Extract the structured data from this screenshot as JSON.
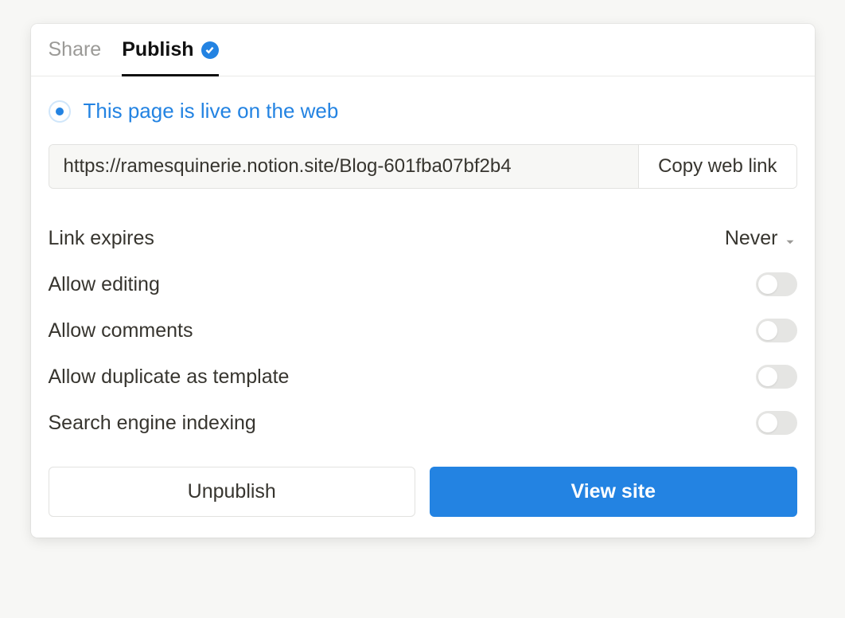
{
  "tabs": {
    "share": "Share",
    "publish": "Publish"
  },
  "status": {
    "live_text": "This page is live on the web"
  },
  "url": {
    "value": "https://ramesquinerie.notion.site/Blog-601fba07bf2b4",
    "copy_label": "Copy web link"
  },
  "settings": {
    "link_expires": {
      "label": "Link expires",
      "value": "Never"
    },
    "allow_editing": {
      "label": "Allow editing",
      "enabled": false
    },
    "allow_comments": {
      "label": "Allow comments",
      "enabled": false
    },
    "allow_duplicate": {
      "label": "Allow duplicate as template",
      "enabled": false
    },
    "search_indexing": {
      "label": "Search engine indexing",
      "enabled": false
    }
  },
  "buttons": {
    "unpublish": "Unpublish",
    "view_site": "View site"
  }
}
